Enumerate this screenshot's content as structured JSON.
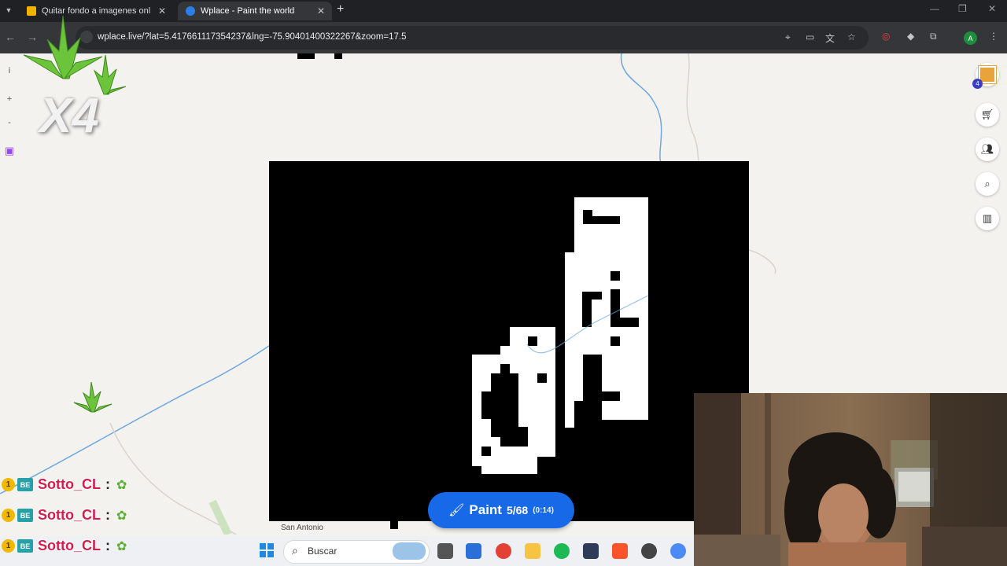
{
  "browser": {
    "tabs": [
      {
        "title": "Quitar fondo a imagenes online",
        "favicon_color": "#f0b400",
        "active": false
      },
      {
        "title": "Wplace - Paint the world",
        "favicon_color": "#2a7ee8",
        "active": true
      }
    ],
    "new_tab_label": "+",
    "url": "wplace.live/?lat=5.417661117354237&lng=-75.90401400322267&zoom=17.5",
    "profile_initial": "A"
  },
  "icons": {
    "tab_menu": "chevron-down-icon",
    "back": "arrow-left-icon",
    "forward": "arrow-right-icon",
    "location": "location-pin-icon",
    "install": "install-app-icon",
    "translate": "translate-icon",
    "bookmark": "star-icon",
    "extensions": "puzzle-icon"
  },
  "map": {
    "left_controls": [
      "i",
      "+",
      "-"
    ],
    "right_badge_count": "4",
    "place_label": "San Antonio"
  },
  "paint": {
    "label": "Paint",
    "charges": "5/68",
    "timer": "(0:14)"
  },
  "overlay": {
    "multiplier": "X4",
    "chat": [
      {
        "badge": "1",
        "badge2": "BE",
        "user": "Sotto_CL",
        "sep": ":"
      },
      {
        "badge": "1",
        "badge2": "BE",
        "user": "Sotto_CL",
        "sep": ":"
      },
      {
        "badge": "1",
        "badge2": "BE",
        "user": "Sotto_CL",
        "sep": ":"
      }
    ]
  },
  "taskbar": {
    "search_placeholder": "Buscar"
  },
  "colors": {
    "paint_button": "#1769e8",
    "chat_name": "#d21e4c",
    "map_bg": "#f4f2ee",
    "river": "#6ea8de"
  }
}
